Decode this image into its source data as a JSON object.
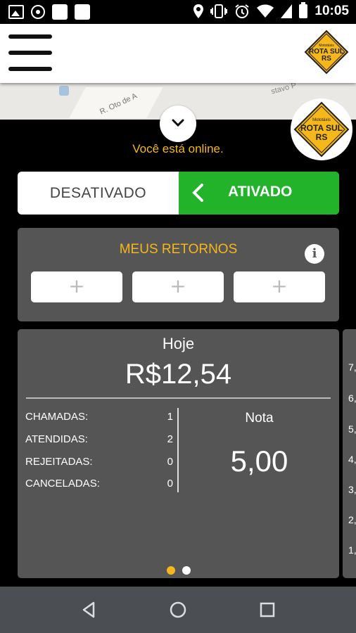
{
  "status_bar": {
    "time": "10:05",
    "left_icons": [
      "image-icon",
      "location-target-icon",
      "app-square-icon",
      "app-square-icon"
    ],
    "right_icons": [
      "location-pin-icon",
      "vibrate-icon",
      "alarm-icon",
      "wifi-icon",
      "battery-icon"
    ]
  },
  "app_bar": {
    "menu_icon": "hamburger-menu-icon",
    "logo_text_top": "Mototáxis",
    "logo_text_main": "ROTA SUL",
    "logo_text_sub": "RS"
  },
  "map": {
    "street_label": "R. Oto de A",
    "street_label_2": "stavo P"
  },
  "status_text": "Você está online.",
  "toggle": {
    "off_label": "DESATIVADO",
    "on_label": "ATIVADO",
    "state": "on"
  },
  "retornos": {
    "title": "MEUS RETORNOS",
    "info_icon": "i",
    "slots": [
      "+",
      "+",
      "+"
    ]
  },
  "summary": {
    "period": "Hoje",
    "amount": "R$12,54",
    "stats": [
      {
        "label": "CHAMADAS:",
        "value": "1"
      },
      {
        "label": "ATENDIDAS:",
        "value": "2"
      },
      {
        "label": "REJEITADAS:",
        "value": "0"
      },
      {
        "label": "CANCELADAS:",
        "value": "0"
      }
    ],
    "nota_label": "Nota",
    "nota_value": "5,00",
    "page_index": 0,
    "page_count": 2
  },
  "next_card_peek": [
    "7,",
    "6,",
    "5,",
    "4,",
    "3,",
    "2,",
    "1,"
  ],
  "colors": {
    "accent": "#f5b71a",
    "active_green": "#22b32b",
    "card_bg": "#555555",
    "nav_bg": "#4b4f54"
  },
  "nav_bar": {
    "icons": [
      "back-icon",
      "home-icon",
      "recents-icon"
    ]
  }
}
